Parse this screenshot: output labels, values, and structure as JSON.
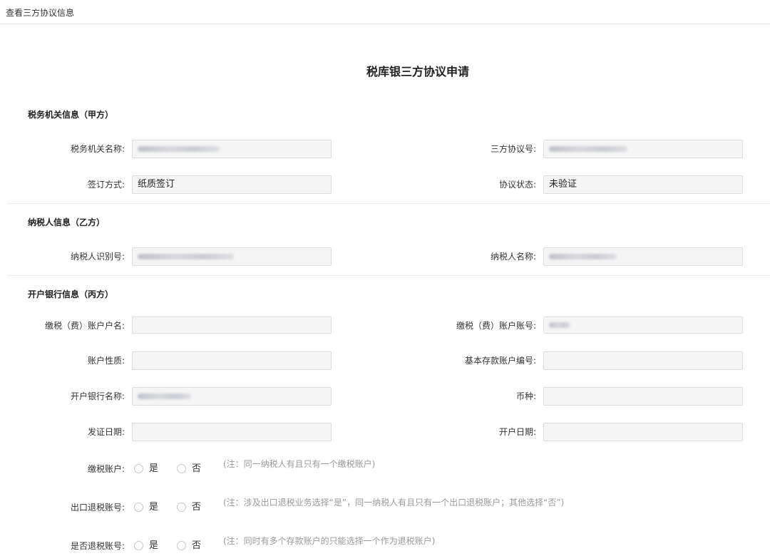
{
  "window": {
    "title": "查看三方协议信息"
  },
  "form": {
    "title": "税库银三方协议申请"
  },
  "sections": {
    "tax_office": {
      "title": "税务机关信息（甲方）"
    },
    "taxpayer": {
      "title": "纳税人信息（乙方）"
    },
    "bank": {
      "title": "开户银行信息（丙方）"
    }
  },
  "fields": {
    "tax_office_name": {
      "label": "税务机关名称:",
      "value": ""
    },
    "agreement_no": {
      "label": "三方协议号:",
      "value": ""
    },
    "sign_method": {
      "label": "签订方式:",
      "value": "纸质签订"
    },
    "agreement_status": {
      "label": "协议状态:",
      "value": "未验证"
    },
    "taxpayer_id": {
      "label": "纳税人识别号:",
      "value": ""
    },
    "taxpayer_name": {
      "label": "纳税人名称:",
      "value": ""
    },
    "account_holder": {
      "label": "缴税（费）账户户名:",
      "value": ""
    },
    "account_number": {
      "label": "缴税（费）账户账号:",
      "value": ""
    },
    "account_nature": {
      "label": "账户性质:",
      "value": ""
    },
    "basic_deposit_no": {
      "label": "基本存款账户编号:",
      "value": ""
    },
    "bank_name": {
      "label": "开户银行名称:",
      "value": ""
    },
    "currency": {
      "label": "币种:",
      "value": ""
    },
    "issue_date": {
      "label": "发证日期:",
      "value": ""
    },
    "open_date": {
      "label": "开户日期:",
      "value": ""
    }
  },
  "radios": {
    "yes_label": "是",
    "no_label": "否",
    "tax_account": {
      "label": "缴税账户:",
      "note": "(注：同一纳税人有且只有一个缴税账户)"
    },
    "export_refund": {
      "label": "出口退税账号:",
      "note": "(注：涉及出口退税业务选择“是”，同一纳税人有且只有一个出口退税账户；其他选择“否”)"
    },
    "is_refund": {
      "label": "是否退税账号:",
      "note": "(注：同时有多个存款账户的只能选择一个作为退税账户)"
    }
  },
  "colors": {
    "field_bg": "#f5f5f5",
    "field_border": "#dcdcdc",
    "note_text": "#999999",
    "divider": "#ececec"
  }
}
